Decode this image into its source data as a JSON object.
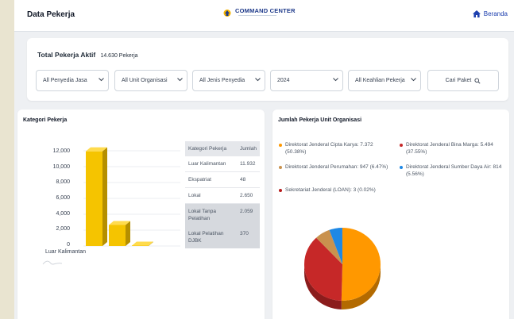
{
  "header": {
    "page_title": "Data Pekerja",
    "brand_name": "COMMAND CENTER",
    "home_label": "Beranda"
  },
  "summary": {
    "label": "Total Pekerja Aktif",
    "value": "14.630 Pekerja"
  },
  "filters": {
    "provider": "All Penyedia Jasa",
    "unit": "All Unit Organisasi",
    "provider_type": "All Jenis Penyedia",
    "year": "2024",
    "skill": "All Keahlian Pekerja",
    "search_label": "Cari Paket"
  },
  "category_card": {
    "title": "Kategori Pekerja",
    "table_headers": [
      "Kategori Pekerja",
      "Jumlah"
    ],
    "rows": [
      {
        "label": "Luar Kalimantan",
        "value": "11.932"
      },
      {
        "label": "Ekspatriat",
        "value": "48"
      },
      {
        "label": "Lokal",
        "value": "2.650"
      },
      {
        "label": "Lokal Tanpa Pelatihan",
        "value": "2.059"
      },
      {
        "label": "Lokal Pelatihan DJBK",
        "value": "370"
      }
    ]
  },
  "unit_card": {
    "title": "Jumlah Pekerja Unit Organisasi",
    "legend": [
      {
        "text": "Direktorat Jenderal Cipta Karya: 7.372 (50.38%)",
        "color": "#ff9800"
      },
      {
        "text": "Direktorat Jenderal Bina Marga: 5.494 (37.55%)",
        "color": "#c62828"
      },
      {
        "text": "Direktorat Jenderal Perumahan: 947 (6.47%)",
        "color": "#c9924e"
      },
      {
        "text": "Direktorat Jenderal Sumber Daya Air: 814 (5.56%)",
        "color": "#1e88e5"
      },
      {
        "text": "Sekretariat Jenderal (LOAN): 3 (0.02%)",
        "color": "#b71c1c"
      }
    ]
  },
  "chart_data": [
    {
      "type": "bar",
      "categories": [
        "Luar Kalimantan",
        "",
        ""
      ],
      "values": [
        11932,
        2650,
        48
      ],
      "ylim": [
        0,
        12000
      ],
      "yticks": [
        "12,000",
        "10,000",
        "8,000",
        "6,000",
        "4,000",
        "2,000",
        "0"
      ],
      "visible_x_label": "Luar Kalimantan",
      "bar_color": "#f5c400"
    },
    {
      "type": "pie",
      "labels": [
        "Direktorat Jenderal Cipta Karya",
        "Direktorat Jenderal Bina Marga",
        "Direktorat Jenderal Perumahan",
        "Direktorat Jenderal Sumber Daya Air",
        "Sekretariat Jenderal (LOAN)"
      ],
      "values": [
        7372,
        5494,
        947,
        814,
        3
      ],
      "colors": [
        "#ff9800",
        "#c62828",
        "#c9924e",
        "#1e88e5",
        "#b71c1c"
      ]
    }
  ]
}
